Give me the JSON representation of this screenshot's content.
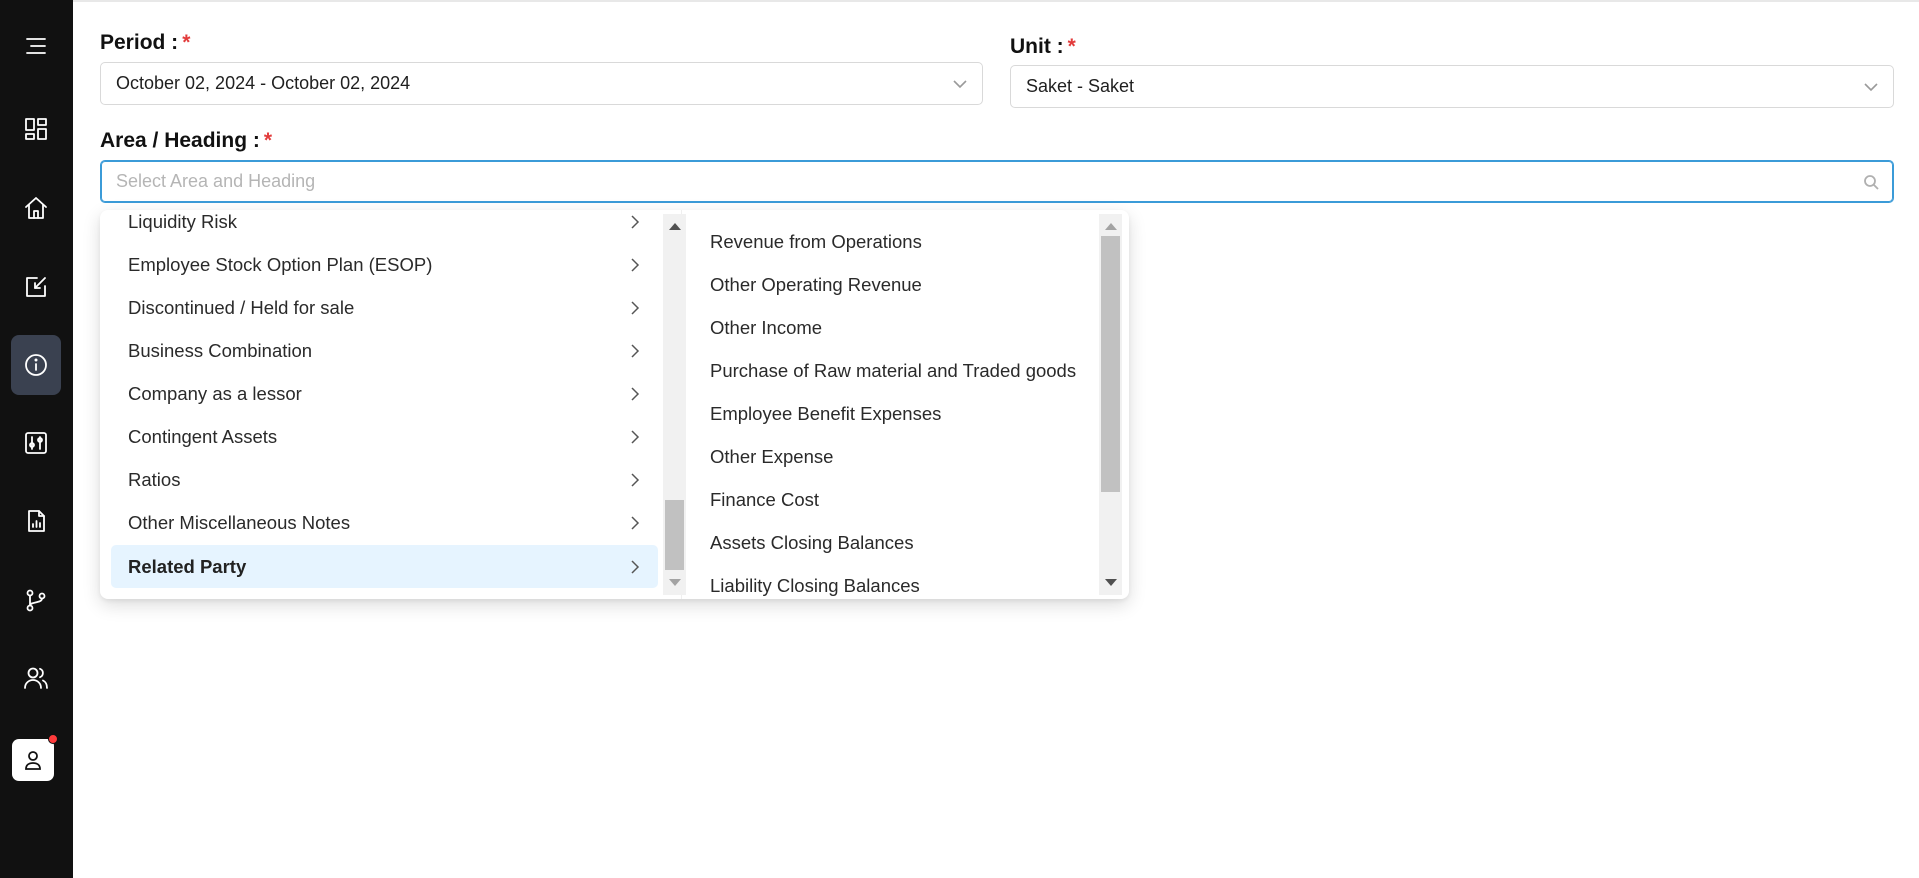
{
  "sidebar": {
    "items": [
      {
        "name": "menu-icon"
      },
      {
        "name": "dashboard-icon"
      },
      {
        "name": "home-icon"
      },
      {
        "name": "edit-checkbox-icon"
      },
      {
        "name": "info-icon",
        "active": true
      },
      {
        "name": "sliders-icon"
      },
      {
        "name": "report-file-icon"
      },
      {
        "name": "git-branch-icon"
      },
      {
        "name": "users-icon"
      }
    ],
    "avatar_icon": "user-icon",
    "notification": true
  },
  "form": {
    "period": {
      "label": "Period :",
      "required_mark": "*",
      "value": "October 02, 2024 - October 02, 2024"
    },
    "unit": {
      "label": "Unit :",
      "required_mark": "*",
      "value": "Saket - Saket"
    },
    "area": {
      "label": "Area / Heading :",
      "required_mark": "*",
      "placeholder": "Select Area and Heading"
    }
  },
  "dropdown": {
    "areas": [
      "Liquidity Risk",
      "Employee Stock Option Plan (ESOP)",
      "Discontinued / Held for sale",
      "Business Combination",
      "Company as a lessor",
      "Contingent Assets",
      "Ratios",
      "Other Miscellaneous Notes",
      "Related Party"
    ],
    "selected_area": "Related Party",
    "headings": [
      "Revenue from Operations",
      "Other Operating Revenue",
      "Other Income",
      "Purchase of Raw material and Traded goods",
      "Employee Benefit Expenses",
      "Other Expense",
      "Finance Cost",
      "Assets Closing Balances",
      "Liability Closing Balances"
    ]
  },
  "colors": {
    "sidebar_bg": "#111111",
    "active_item": "#3a4150",
    "selected_option_bg": "#e6f4ff",
    "focus_border": "#3b9bd8",
    "required": "#e23b3b"
  }
}
